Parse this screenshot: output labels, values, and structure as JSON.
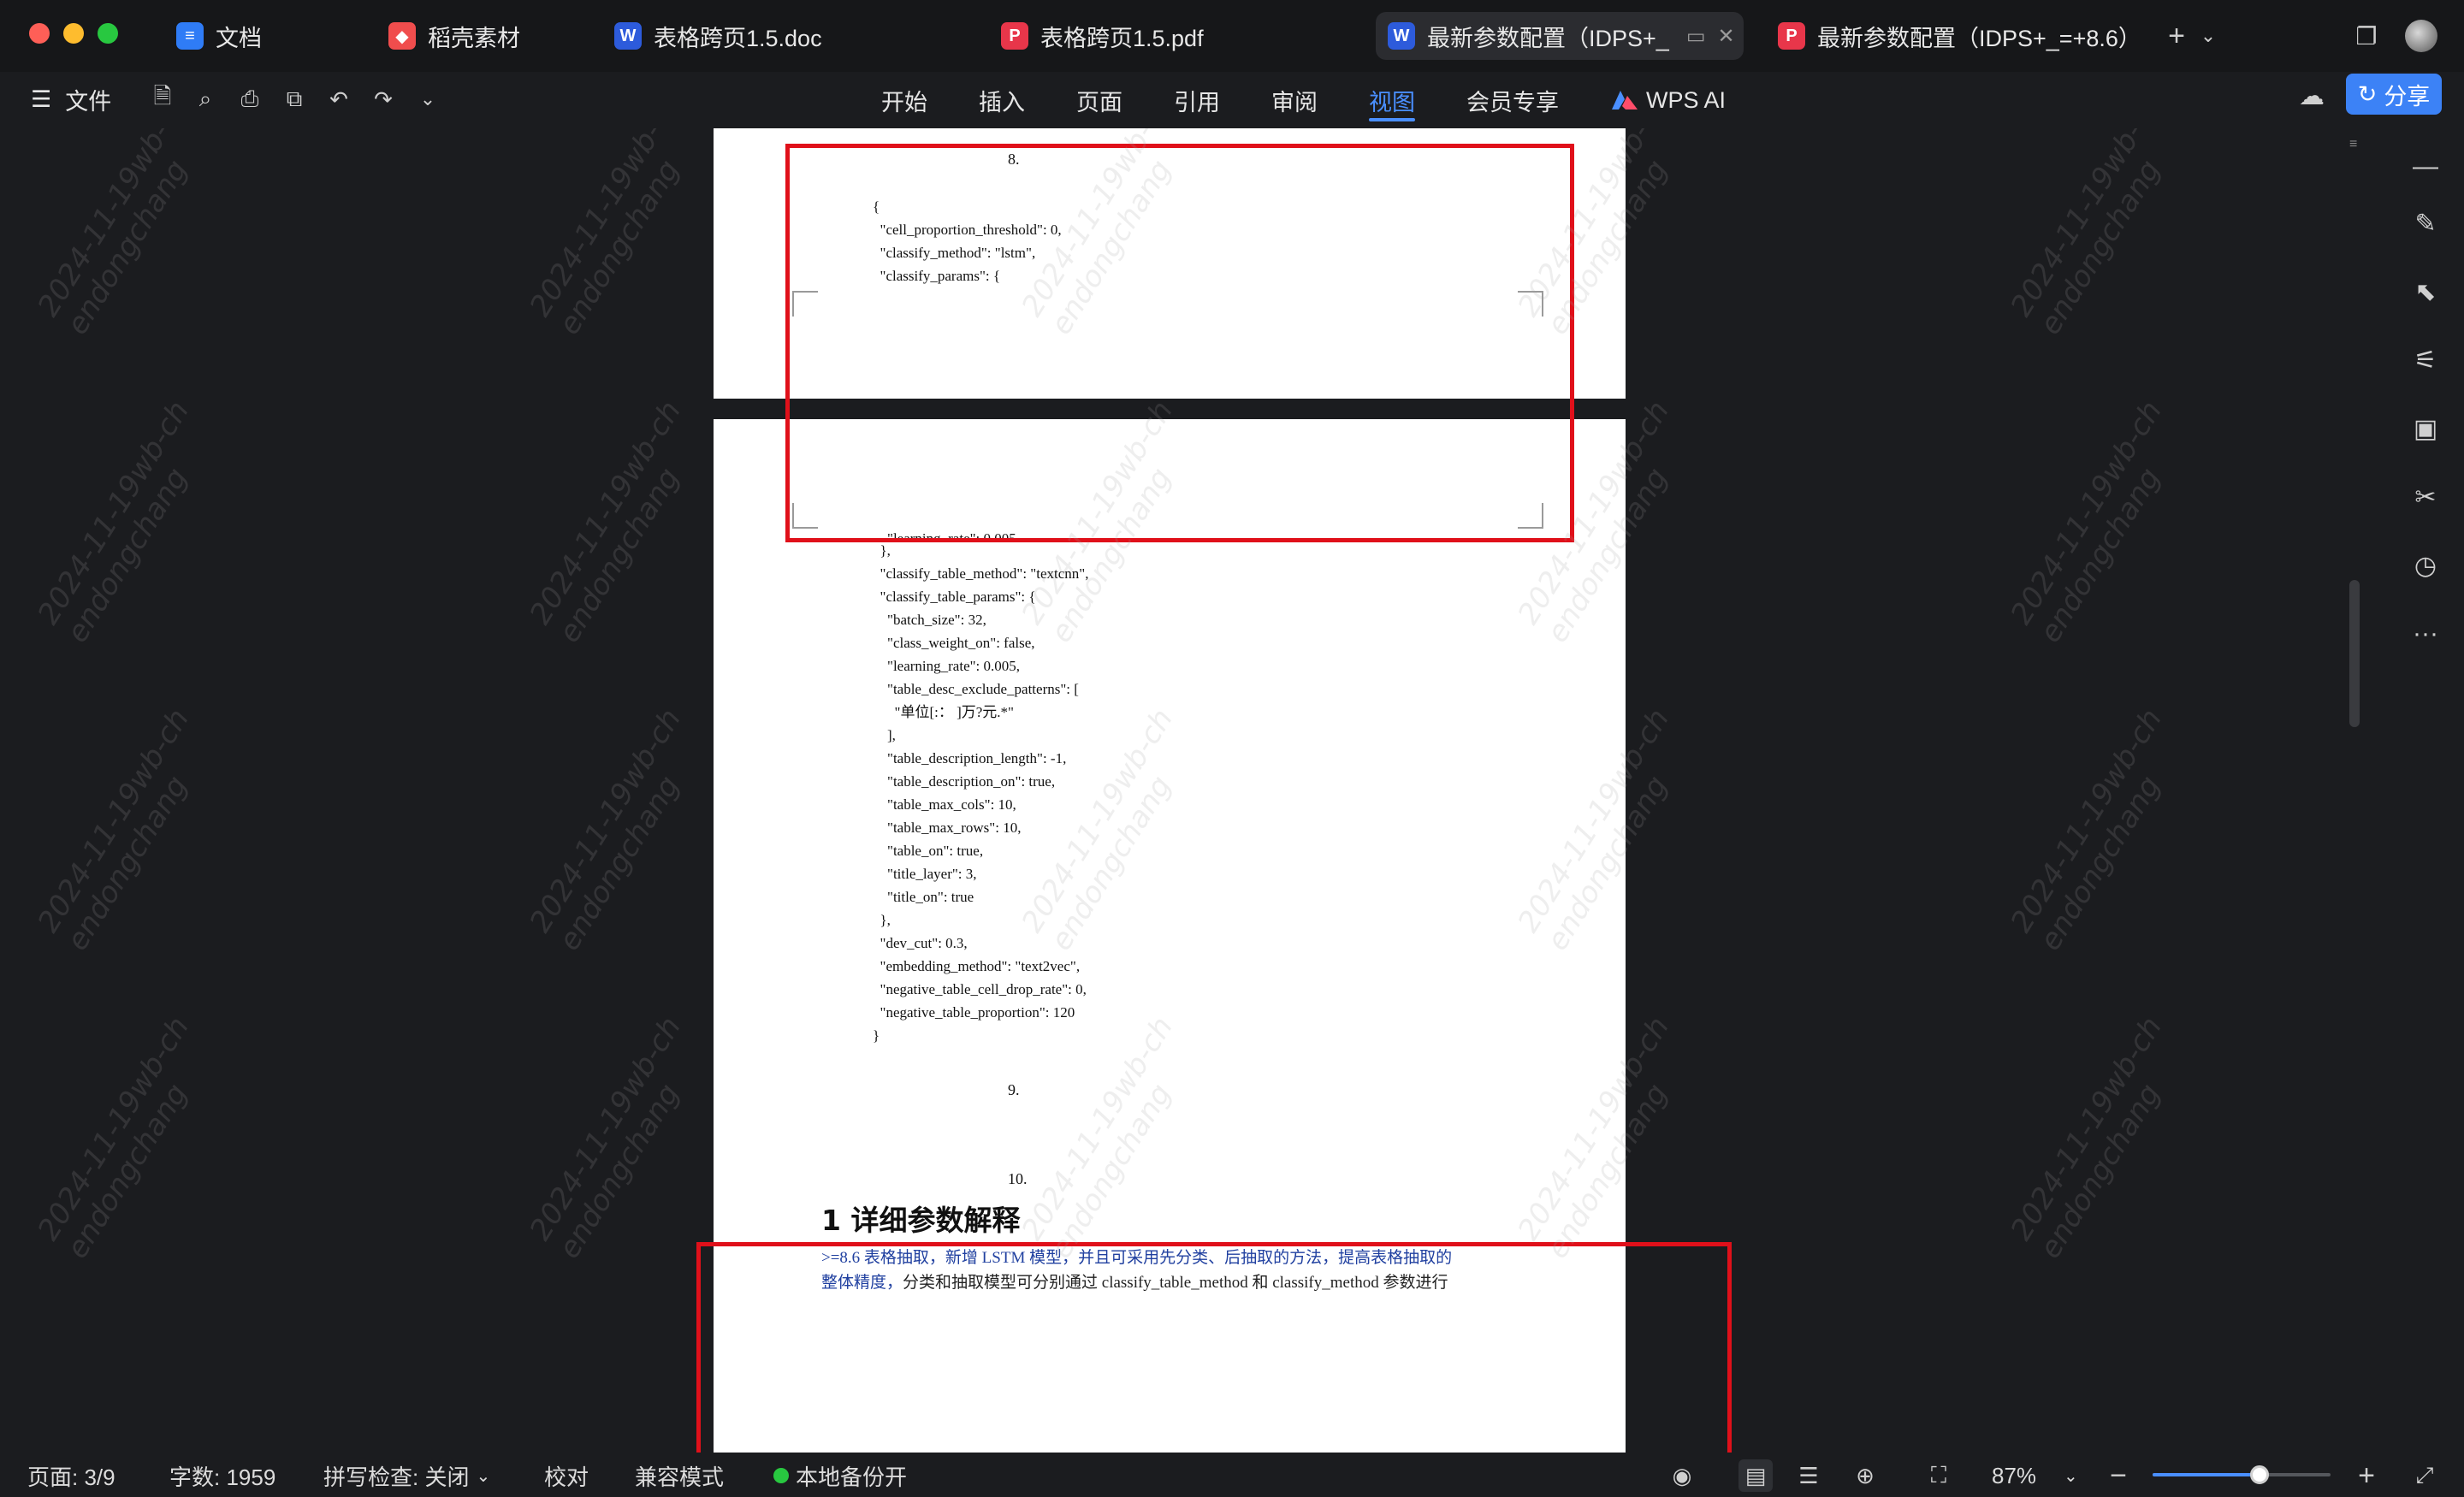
{
  "tabs": [
    {
      "label": "文档",
      "icon": "doc-app-icon",
      "glyph": "≡"
    },
    {
      "label": "稻壳素材",
      "icon": "docer-icon",
      "glyph": "◆"
    },
    {
      "label": "表格跨页1.5.doc",
      "icon": "word-doc-icon",
      "glyph": "W"
    },
    {
      "label": "表格跨页1.5.pdf",
      "icon": "pdf-doc-icon",
      "glyph": "P"
    },
    {
      "label": "最新参数配置（IDPS+_",
      "icon": "word-doc-icon",
      "glyph": "W"
    },
    {
      "label": "最新参数配置（IDPS+_=+8.6）",
      "icon": "pdf-doc-icon",
      "glyph": "P"
    }
  ],
  "toolbar": {
    "file_label": "文件",
    "menu": [
      "开始",
      "插入",
      "页面",
      "引用",
      "审阅",
      "视图",
      "会员专享"
    ],
    "active_menu": "视图",
    "wps_ai": "WPS AI",
    "share": "分享"
  },
  "document": {
    "page1": {
      "list_number": "8.",
      "code": "{\n  \"cell_proportion_threshold\": 0,\n  \"classify_method\": \"lstm\",\n  \"classify_params\": {"
    },
    "page2": {
      "cut_line": "    \"learning_rate\": 0.005",
      "code": "  },\n  \"classify_table_method\": \"textcnn\",\n  \"classify_table_params\": {\n    \"batch_size\": 32,\n    \"class_weight_on\": false,\n    \"learning_rate\": 0.005,\n    \"table_desc_exclude_patterns\": [\n      \"单位[:： ]万?元.*\"\n    ],\n    \"table_description_length\": -1,\n    \"table_description_on\": true,\n    \"table_max_cols\": 10,\n    \"table_max_rows\": 10,\n    \"table_on\": true,\n    \"title_layer\": 3,\n    \"title_on\": true\n  },\n  \"dev_cut\": 0.3,\n  \"embedding_method\": \"text2vec\",\n  \"negative_table_cell_drop_rate\": 0,\n  \"negative_table_proportion\": 120\n}",
      "list_number_9": "9.",
      "list_number_10": "10.",
      "heading": "1 详细参数解释",
      "para_line1": ">=8.6  表格抽取，新增 LSTM 模型，并且可采用先分类、后抽取的方法，提高表格抽取的",
      "para_line2_blue": "整体精度，",
      "para_line2_black": "分类和抽取模型可分别通过 classify_table_method 和 classify_method 参数进行"
    }
  },
  "watermark": {
    "line1": "2024-11-19wb-ch",
    "line2": "endongchang"
  },
  "statusbar": {
    "page": "页面: 3/9",
    "words": "字数: 1959",
    "spell": "拼写检查: 关闭",
    "proof": "校对",
    "compat": "兼容模式",
    "backup": "本地备份开",
    "zoom": "87%",
    "zoom_level": 0.6
  },
  "colors": {
    "accent": "#4a8fff",
    "highlight_box": "#e0101a",
    "share": "#3c82f6"
  }
}
